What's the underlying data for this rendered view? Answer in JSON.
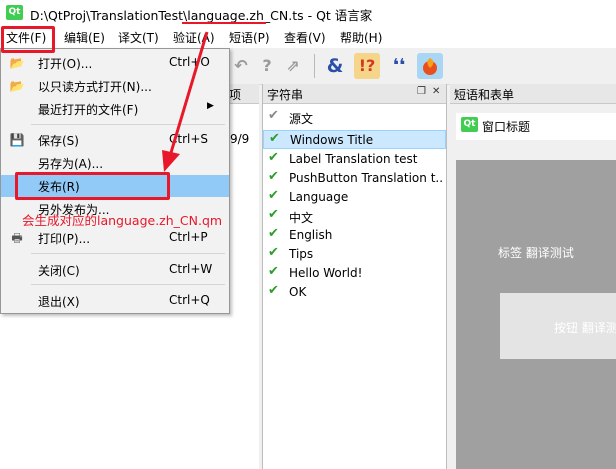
{
  "window": {
    "title": "D:\\QtProj\\TranslationTest\\language.zh_CN.ts - Qt 语言家",
    "icon": "qt-logo-icon",
    "icon_text": "Qt"
  },
  "menubar": {
    "items": [
      "文件(F)",
      "编辑(E)",
      "译文(T)",
      "验证(A)",
      "短语(P)",
      "查看(V)",
      "帮助(H)"
    ]
  },
  "toolbar": {
    "icons": [
      "undo-arrow-icon",
      "question-check-icon",
      "question-arrow-icon",
      "ampersand-accelerator-icon",
      "punctuation-warning-icon",
      "quote-phrase-icon",
      "placeholder-check-icon"
    ]
  },
  "file_menu": {
    "items": [
      {
        "label": "打开(O)...",
        "shortcut": "Ctrl+O",
        "icon": "folder-open-icon"
      },
      {
        "label": "以只读方式打开(N)...",
        "shortcut": "",
        "icon": "folder-open-icon"
      },
      {
        "label": "最近打开的文件(F)",
        "shortcut": "",
        "icon": "",
        "submenu": true
      },
      {
        "label": "保存(S)",
        "shortcut": "Ctrl+S",
        "icon": "save-disk-icon"
      },
      {
        "label": "另存为(A)...",
        "shortcut": "",
        "icon": ""
      },
      {
        "label": "发布(R)",
        "shortcut": "",
        "icon": "",
        "highlighted": true
      },
      {
        "label": "另外发布为...",
        "shortcut": "",
        "icon": ""
      },
      {
        "label": "打印(P)...",
        "shortcut": "Ctrl+P",
        "icon": "printer-icon"
      },
      {
        "label": "关闭(C)",
        "shortcut": "Ctrl+W",
        "icon": ""
      },
      {
        "label": "退出(X)",
        "shortcut": "Ctrl+Q",
        "icon": ""
      }
    ]
  },
  "context_panel": {
    "header_partial": "项",
    "count_partial": "9/9"
  },
  "strings_panel": {
    "title": "字符串",
    "source_header": "源文",
    "rows": [
      {
        "text": "Windows Title",
        "selected": true
      },
      {
        "text": "Label Translation test"
      },
      {
        "text": "PushButton Translation t..."
      },
      {
        "text": "Language"
      },
      {
        "text": "中文"
      },
      {
        "text": "English"
      },
      {
        "text": "Tips"
      },
      {
        "text": "Hello World!"
      },
      {
        "text": "OK"
      }
    ]
  },
  "phrases_panel": {
    "title": "短语和表单",
    "form_title": "窗口标题",
    "label_text": "标签  翻译测试",
    "button_text": "按钮  翻译测"
  },
  "annotation": {
    "text": "会生成对应的language.zh_CN.qm"
  },
  "colors": {
    "annotation_red": "#e8182a",
    "menu_highlight": "#91c9f7",
    "selected_row": "#cce8ff",
    "check_green": "#2a9d2a",
    "qt_green": "#41cd52"
  }
}
